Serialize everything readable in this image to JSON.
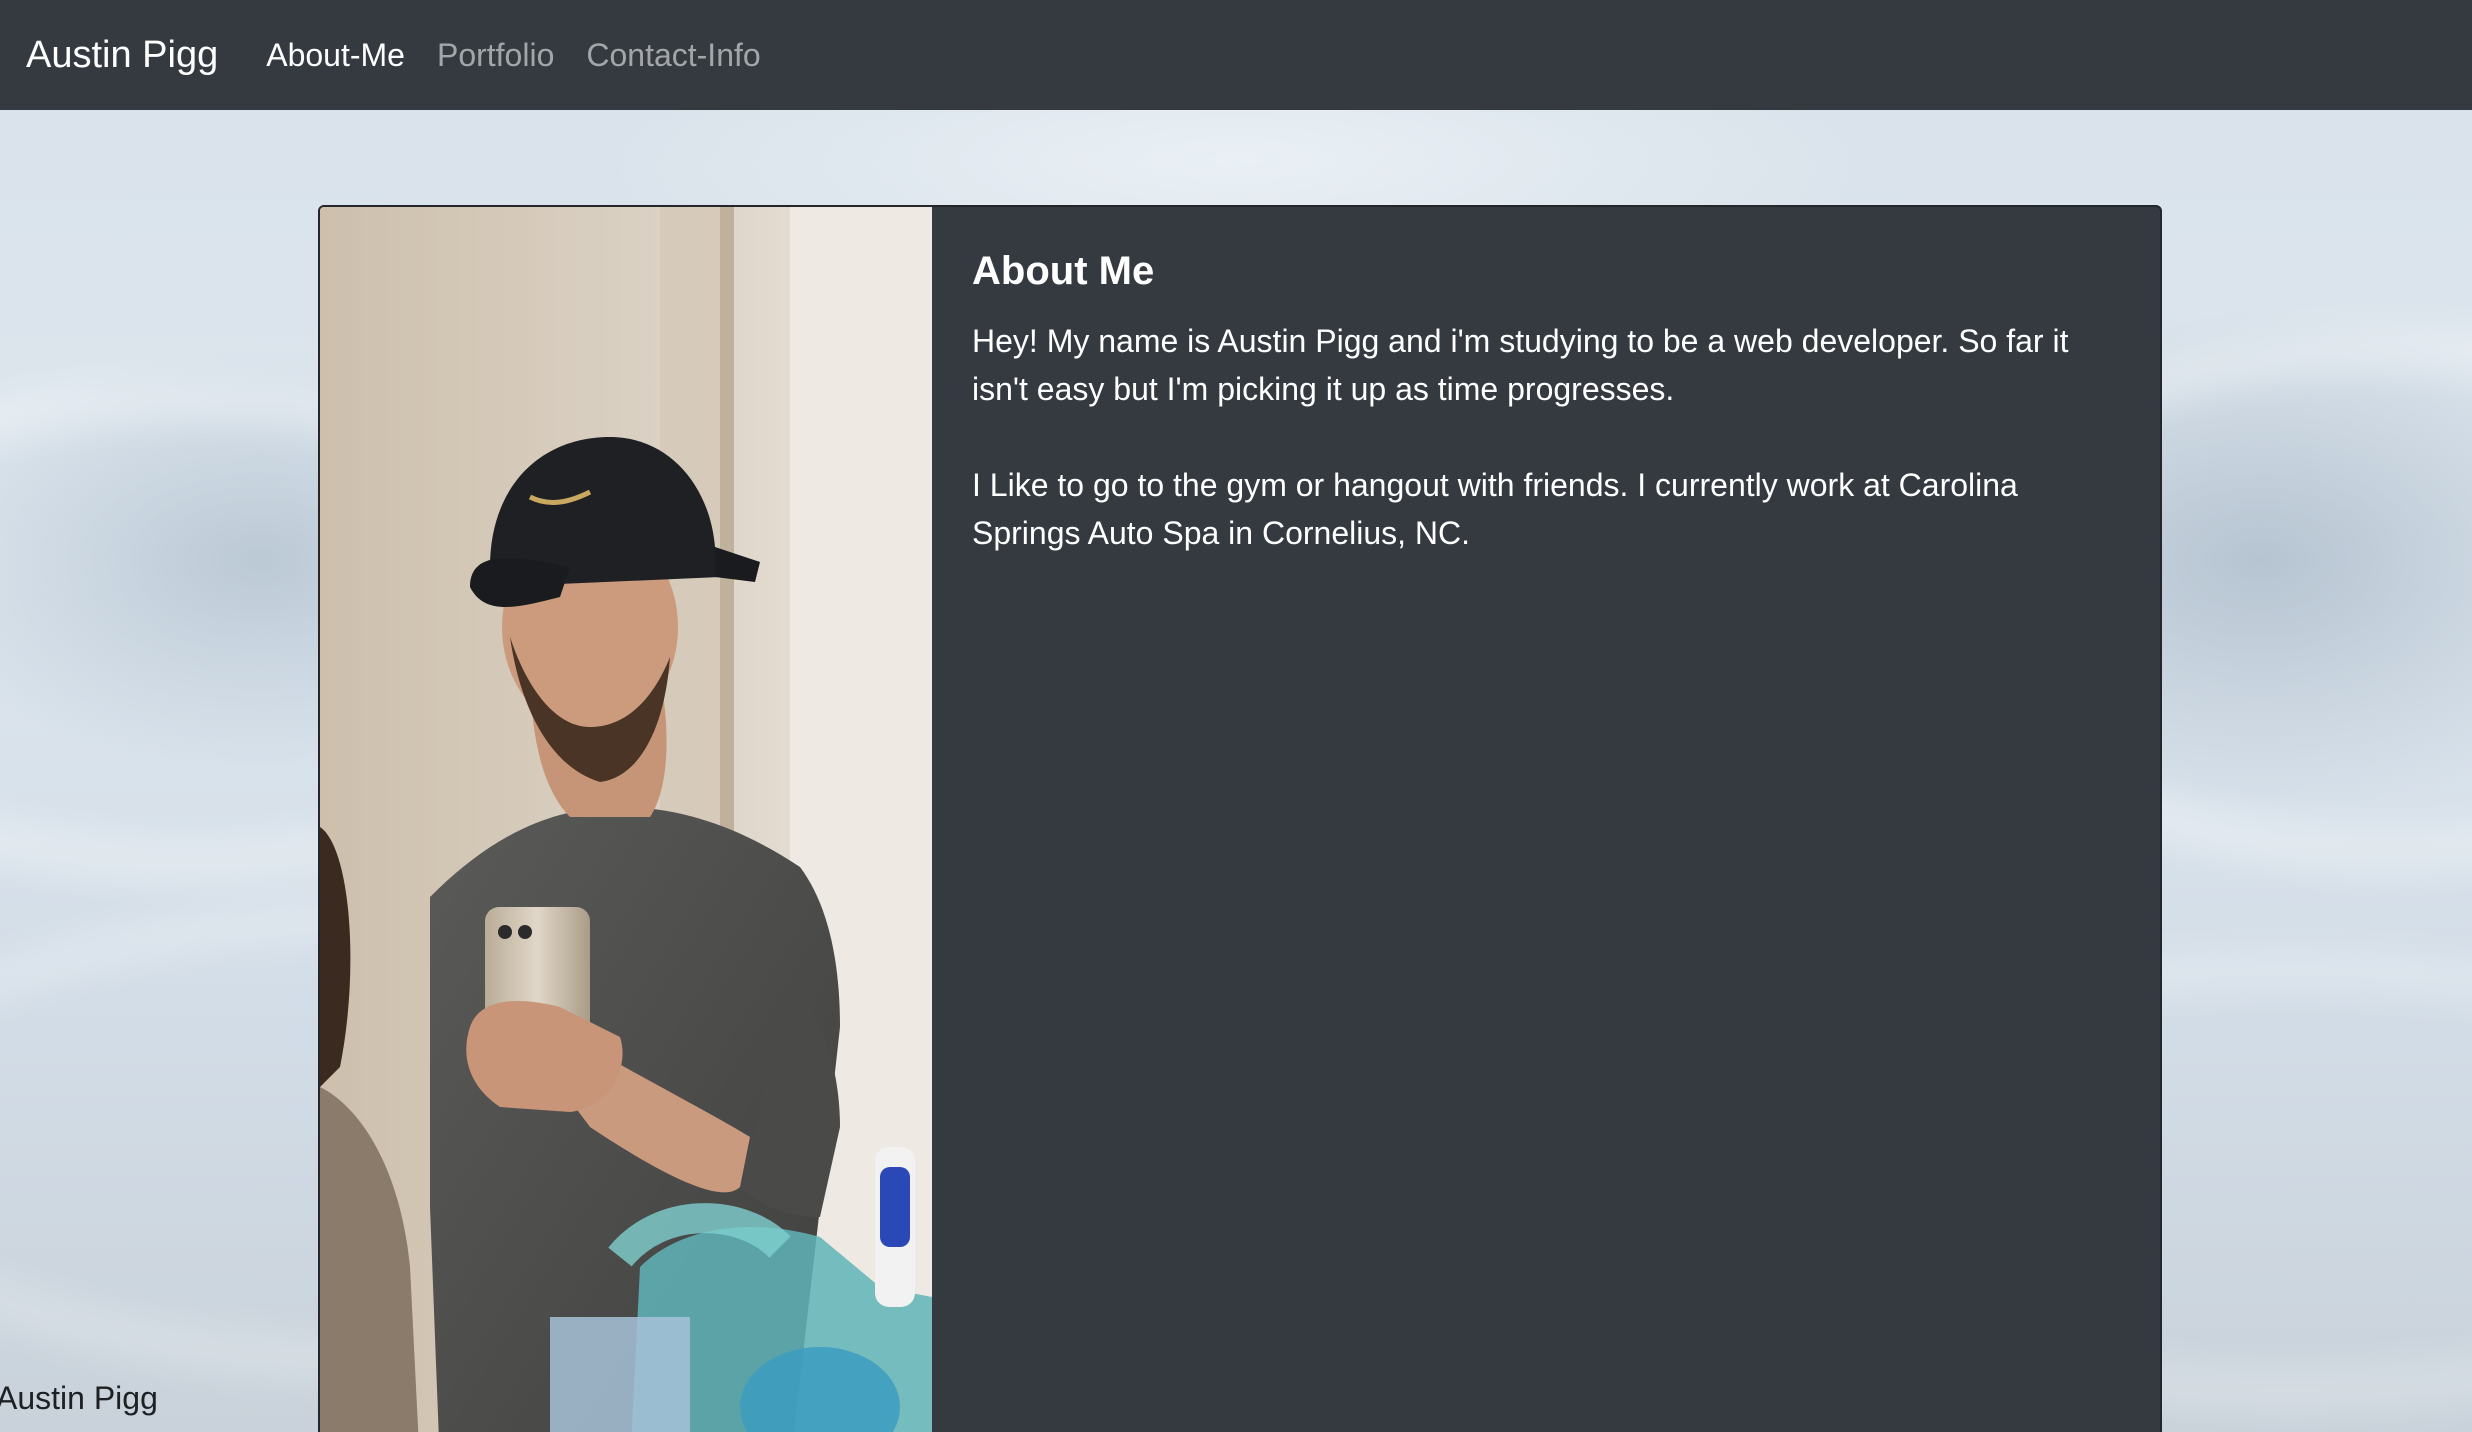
{
  "navbar": {
    "brand": "Austin Pigg",
    "links": [
      {
        "label": "About-Me",
        "active": true
      },
      {
        "label": "Portfolio",
        "active": false
      },
      {
        "label": "Contact-Info",
        "active": false
      }
    ]
  },
  "card": {
    "image_alt": "Mirror selfie photo",
    "title": "About Me",
    "paragraphs": [
      "Hey! My name is Austin Pigg and i'm studying to be a web developer. So far it isn't easy but I'm picking it up as time progresses.",
      "I Like to go to the gym or hangout with friends. I currently work at Carolina Springs Auto Spa in Cornelius, NC."
    ]
  },
  "footer": {
    "text": "Austin Pigg"
  },
  "colors": {
    "navbar_bg": "#343a40",
    "card_bg": "#343a40",
    "page_bg": "#d6e0e9"
  }
}
